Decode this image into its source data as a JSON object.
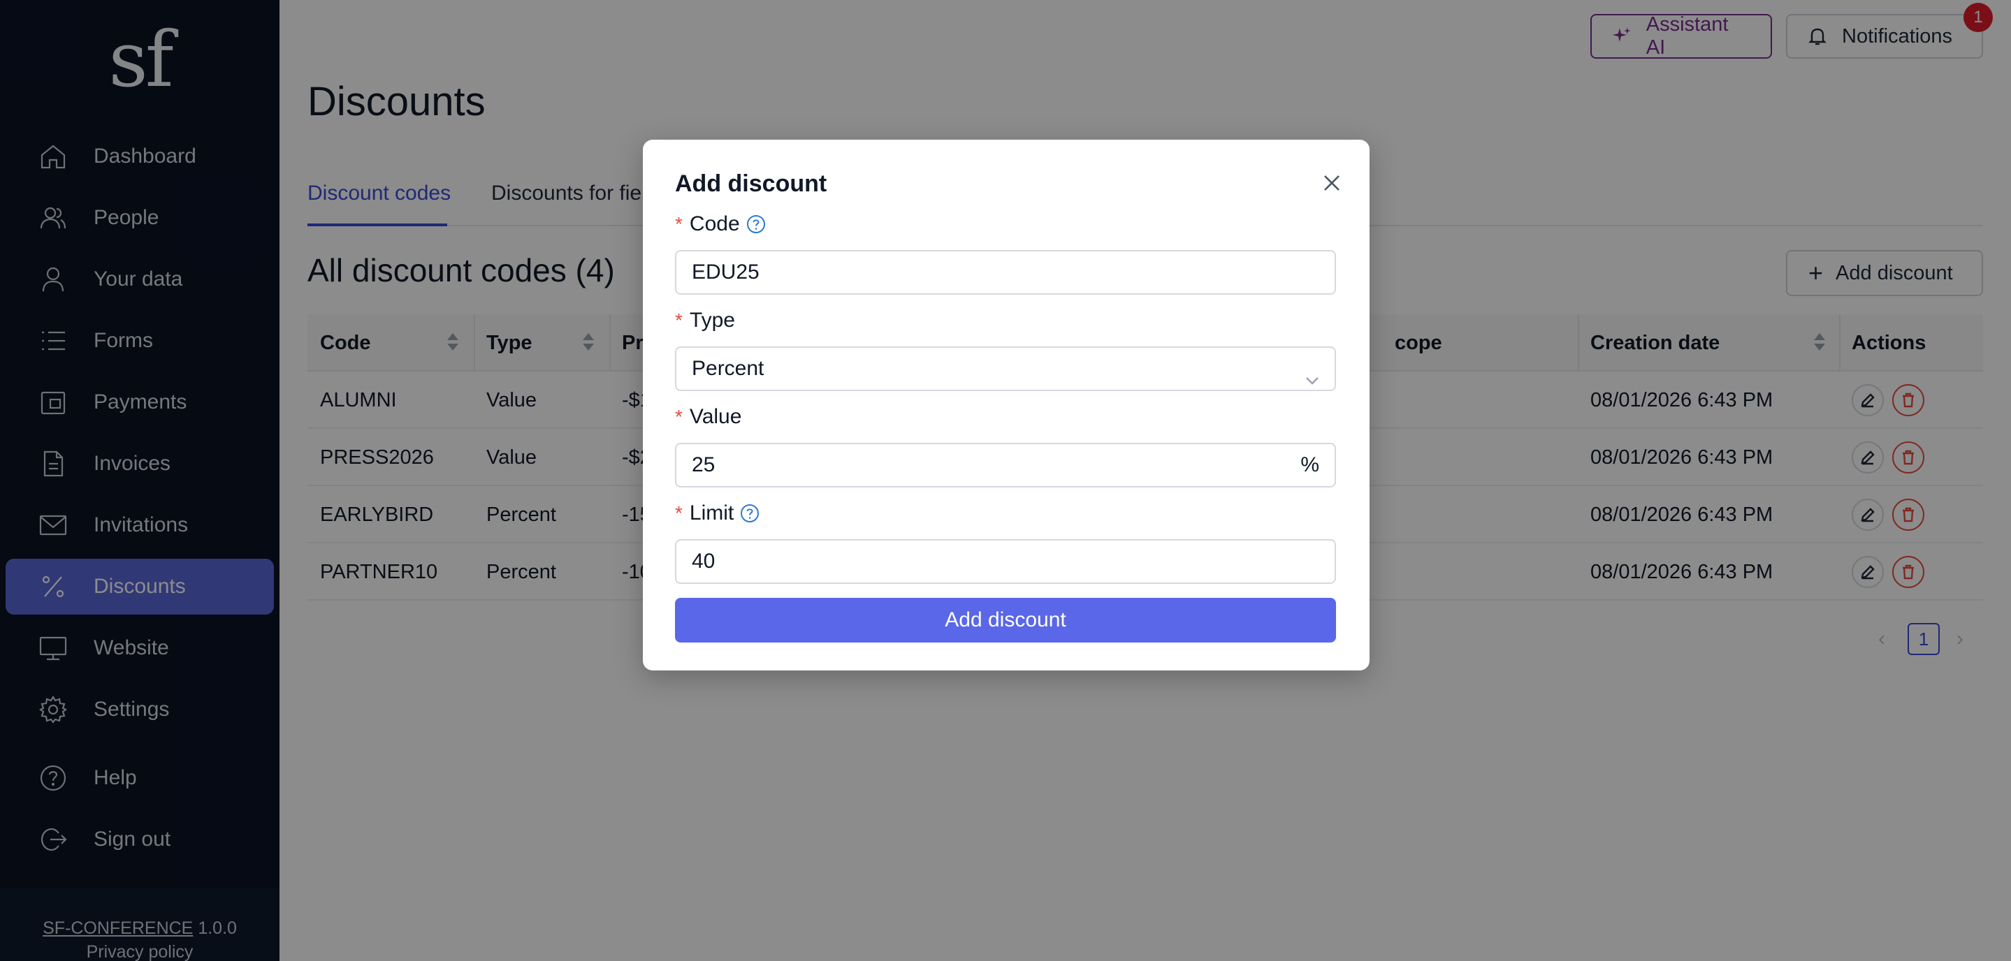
{
  "brand": {
    "logo_text": "sf"
  },
  "sidebar": {
    "items": [
      {
        "label": "Dashboard",
        "icon": "home-icon"
      },
      {
        "label": "People",
        "icon": "people-icon"
      },
      {
        "label": "Your data",
        "icon": "user-icon"
      },
      {
        "label": "Forms",
        "icon": "list-icon"
      },
      {
        "label": "Payments",
        "icon": "wallet-icon"
      },
      {
        "label": "Invoices",
        "icon": "document-icon"
      },
      {
        "label": "Invitations",
        "icon": "mail-icon"
      },
      {
        "label": "Discounts",
        "icon": "percent-icon",
        "active": true
      },
      {
        "label": "Website",
        "icon": "monitor-icon"
      },
      {
        "label": "Settings",
        "icon": "gear-icon"
      }
    ],
    "bottom_items": [
      {
        "label": "Help",
        "icon": "help-icon"
      },
      {
        "label": "Sign out",
        "icon": "sign-out-icon"
      }
    ],
    "footer": {
      "app_link": "SF-CONFERENCE",
      "version": "1.0.0",
      "privacy": "Privacy policy"
    }
  },
  "header": {
    "assistant_label": "Assistant AI",
    "notifications_label": "Notifications",
    "notifications_count": "1"
  },
  "page": {
    "title": "Discounts",
    "tabs": [
      {
        "label": "Discount codes",
        "active": true
      },
      {
        "label": "Discounts for fiel"
      }
    ],
    "section_title": "All discount codes (4)",
    "add_button": "Add discount"
  },
  "table": {
    "columns": [
      "Code",
      "Type",
      "Pr",
      "cope",
      "Creation date",
      "Actions"
    ],
    "rows": [
      {
        "code": "ALUMNI",
        "type": "Value",
        "price": "-$1",
        "created": "08/01/2026 6:43 PM"
      },
      {
        "code": "PRESS2026",
        "type": "Value",
        "price": "-$2",
        "created": "08/01/2026 6:43 PM"
      },
      {
        "code": "EARLYBIRD",
        "type": "Percent",
        "price": "-15",
        "created": "08/01/2026 6:43 PM"
      },
      {
        "code": "PARTNER10",
        "type": "Percent",
        "price": "-10",
        "created": "08/01/2026 6:43 PM"
      }
    ]
  },
  "pagination": {
    "current_page": "1",
    "prev": "‹",
    "next": "›"
  },
  "modal": {
    "title": "Add discount",
    "required_mark": "*",
    "code": {
      "label": "Code",
      "value": "EDU25"
    },
    "type": {
      "label": "Type",
      "value": "Percent"
    },
    "value": {
      "label": "Value",
      "value": "25",
      "suffix": "%"
    },
    "limit": {
      "label": "Limit",
      "value": "40"
    },
    "submit_label": "Add discount"
  },
  "colors": {
    "sidebar_bg": "#0a1324",
    "accent": "#5a67d8",
    "assistant": "#7b2e8f",
    "danger": "#e74c3c",
    "badge": "#e11d2c"
  }
}
